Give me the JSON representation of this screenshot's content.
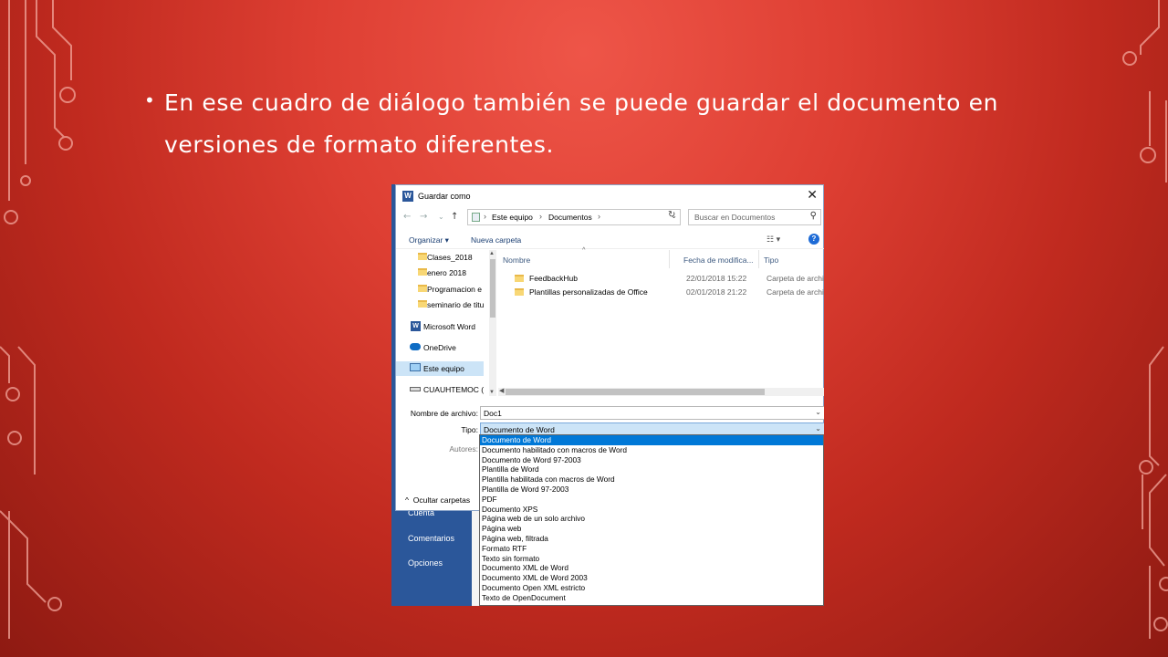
{
  "bullet": {
    "line1": "En ese cuadro de diálogo también se puede guardar el documento en",
    "line2": "versiones de formato diferentes."
  },
  "dialog": {
    "title": "Guardar como",
    "address": [
      "Este equipo",
      "Documentos"
    ],
    "search_placeholder": "Buscar en Documentos",
    "toolbar": {
      "organize": "Organizar ▾",
      "new_folder": "Nueva carpeta"
    },
    "nav_items": [
      {
        "label": "Clases_2018",
        "icon": "folder-icon"
      },
      {
        "label": "enero 2018",
        "icon": "folder-icon"
      },
      {
        "label": "Programacion e",
        "icon": "folder-icon"
      },
      {
        "label": "seminario de titu",
        "icon": "folder-icon"
      },
      {
        "label": "Microsoft Word",
        "icon": "word-icon"
      },
      {
        "label": "OneDrive",
        "icon": "cloud-icon"
      },
      {
        "label": "Este equipo",
        "icon": "computer-icon"
      },
      {
        "label": "CUAUHTEMOC (D",
        "icon": "drive-icon"
      }
    ],
    "columns": [
      "Nombre",
      "Fecha de modifica...",
      "Tipo"
    ],
    "files": [
      {
        "name": "FeedbackHub",
        "date": "22/01/2018 15:22",
        "type": "Carpeta de archiv"
      },
      {
        "name": "Plantillas personalizadas de Office",
        "date": "02/01/2018 21:22",
        "type": "Carpeta de archiv"
      }
    ],
    "filename_label": "Nombre de archivo:",
    "filename_value": "Doc1",
    "type_label": "Tipo:",
    "type_value": "Documento de Word",
    "authors_label": "Autores:",
    "hide_folders": "Ocultar carpetas"
  },
  "file_types": [
    "Documento de Word",
    "Documento habilitado con macros de Word",
    "Documento de Word 97-2003",
    "Plantilla de Word",
    "Plantilla habilitada con macros de Word",
    "Plantilla de Word 97-2003",
    "PDF",
    "Documento XPS",
    "Página web de un solo archivo",
    "Página web",
    "Página web, filtrada",
    "Formato RTF",
    "Texto sin formato",
    "Documento XML de Word",
    "Documento XML de Word 2003",
    "Documento Open XML estricto",
    "Texto de OpenDocument"
  ],
  "backstage": {
    "item1": "Cuenta",
    "item2": "Comentarios",
    "item3": "Opciones"
  },
  "colors": {
    "background": "#de3f33",
    "accent_line": "#f3a79c",
    "word_blue": "#2b579a",
    "selection": "#0078d7"
  }
}
